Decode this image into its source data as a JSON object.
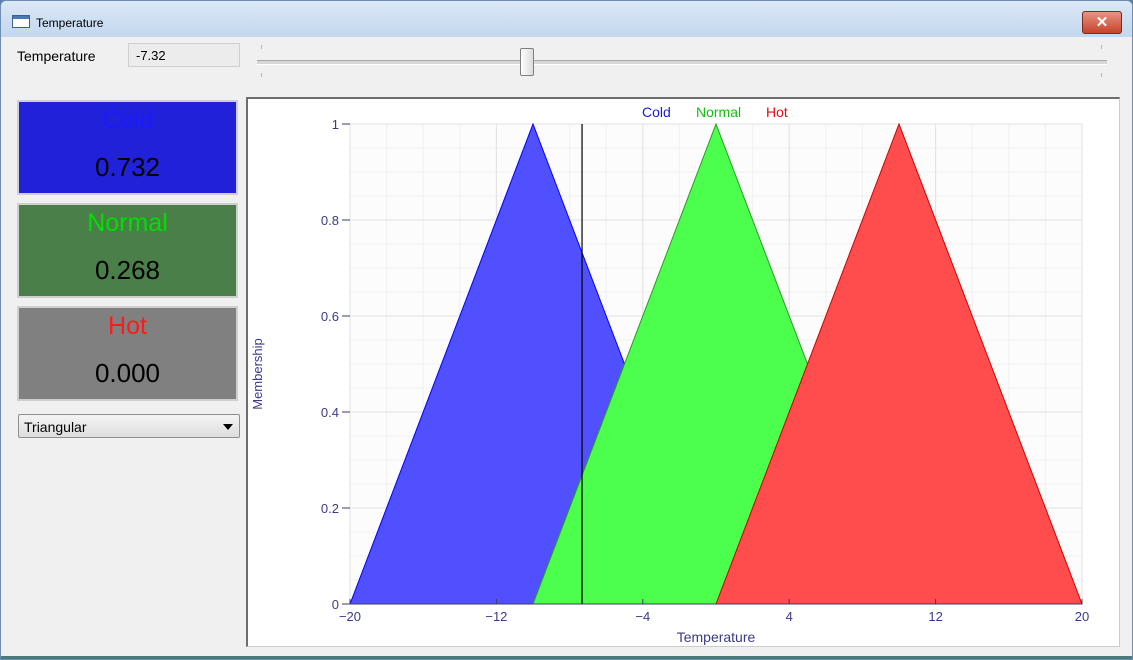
{
  "window": {
    "title": "Temperature",
    "close_label": "✕"
  },
  "toolbar": {
    "temperature_label": "Temperature",
    "temperature_value": "-7.32",
    "slider": {
      "min": -20,
      "max": 20,
      "value": -7.32
    }
  },
  "cards": [
    {
      "name": "Cold",
      "value": "0.732",
      "name_color": "#1a1aff",
      "bg": "#2121d9"
    },
    {
      "name": "Normal",
      "value": "0.268",
      "name_color": "#00e000",
      "bg": "#4a7f4a"
    },
    {
      "name": "Hot",
      "value": "0.000",
      "name_color": "#ff1a1a",
      "bg": "#808080"
    }
  ],
  "shape_select": {
    "value": "Triangular"
  },
  "chart_data": {
    "type": "area",
    "xlabel": "Temperature",
    "ylabel": "Membership",
    "xlim": [
      -20,
      20
    ],
    "ylim": [
      0,
      1
    ],
    "x_ticks": [
      -20,
      -12,
      -4,
      4,
      12,
      20
    ],
    "x_tick_labels": [
      "−20",
      "−12",
      "−4",
      "4",
      "12",
      "20"
    ],
    "y_ticks": [
      0,
      0.2,
      0.4,
      0.6,
      0.8,
      1
    ],
    "y_tick_labels": [
      "0",
      "0.2",
      "0.4",
      "0.6",
      "0.8",
      "1"
    ],
    "grid": true,
    "legend_position": "top-center",
    "current_x": -7.32,
    "series": [
      {
        "name": "Cold",
        "fill": "#5050ff",
        "stroke": "#0000ff",
        "legend_color": "#1a1ad0",
        "points": [
          [
            -20,
            0
          ],
          [
            -10,
            1
          ],
          [
            0,
            0
          ]
        ]
      },
      {
        "name": "Normal",
        "fill": "#4cff4c",
        "stroke": "#2a9a2a",
        "legend_color": "#10c010",
        "points": [
          [
            -10,
            0
          ],
          [
            0,
            1
          ],
          [
            10,
            0
          ]
        ]
      },
      {
        "name": "Hot",
        "fill": "#ff4c4c",
        "stroke": "#d00000",
        "legend_color": "#e01010",
        "points": [
          [
            0,
            0
          ],
          [
            10,
            1
          ],
          [
            20,
            0
          ]
        ]
      }
    ]
  }
}
